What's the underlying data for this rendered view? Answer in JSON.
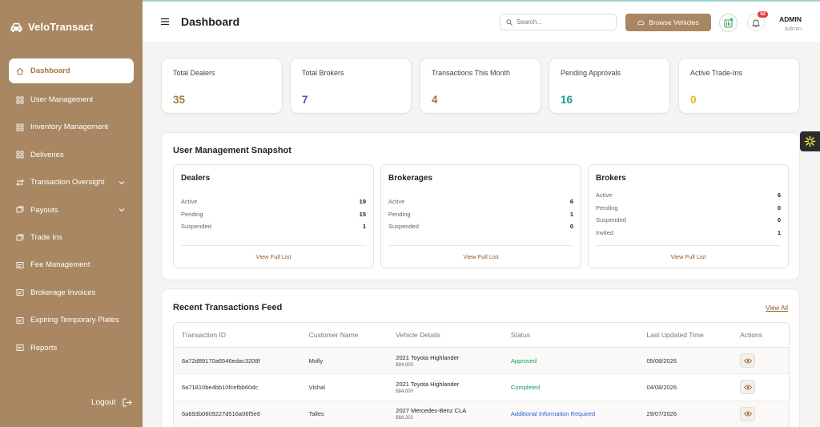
{
  "brand": {
    "name": "VeloTransact"
  },
  "sidebar": {
    "items": [
      {
        "label": "Dashboard",
        "icon": "home-icon"
      },
      {
        "label": "User Management",
        "icon": "grid-icon"
      },
      {
        "label": "Inventory Management",
        "icon": "grid-icon"
      },
      {
        "label": "Deliveries",
        "icon": "grid-icon"
      },
      {
        "label": "Transaction Oversight",
        "icon": "transfer-icon"
      },
      {
        "label": "Payouts",
        "icon": "payout-icon"
      },
      {
        "label": "Trade Ins",
        "icon": "tradein-icon"
      },
      {
        "label": "Fee Management",
        "icon": "fee-icon"
      },
      {
        "label": "Brokerage Invoices",
        "icon": "invoice-icon"
      },
      {
        "label": "Expiring Temporary Plates",
        "icon": "plate-icon"
      },
      {
        "label": "Reports",
        "icon": "report-icon"
      }
    ],
    "logout_label": "Logout"
  },
  "header": {
    "title": "Dashboard",
    "search_placeholder": "Search...",
    "browse_label": "Browse Vehicles",
    "notification_count": "52",
    "user_name": "ADMIN",
    "user_role": "Admin"
  },
  "stats": [
    {
      "label": "Total Dealers",
      "value": "35",
      "color": "#a5763e"
    },
    {
      "label": "Total Brokers",
      "value": "7",
      "color": "#4b52c8"
    },
    {
      "label": "Transactions This Month",
      "value": "4",
      "color": "#a5763e"
    },
    {
      "label": "Pending Approvals",
      "value": "16",
      "color": "#16a085"
    },
    {
      "label": "Active Trade-Ins",
      "value": "0",
      "color": "#e9b318"
    }
  ],
  "snapshot": {
    "title": "User Management Snapshot",
    "link_label": "View Full List",
    "cards": [
      {
        "title": "Dealers",
        "rows": [
          {
            "k": "Active",
            "v": "19"
          },
          {
            "k": "Pending",
            "v": "15"
          },
          {
            "k": "Suspended",
            "v": "1"
          }
        ]
      },
      {
        "title": "Brokerages",
        "rows": [
          {
            "k": "Active",
            "v": "6"
          },
          {
            "k": "Pending",
            "v": "1"
          },
          {
            "k": "Suspended",
            "v": "0"
          }
        ]
      },
      {
        "title": "Brokers",
        "rows": [
          {
            "k": "Active",
            "v": "6"
          },
          {
            "k": "Pending",
            "v": "0"
          },
          {
            "k": "Suspended",
            "v": "0"
          },
          {
            "k": "Invited",
            "v": "1"
          }
        ]
      }
    ]
  },
  "feed": {
    "title": "Recent Transactions Feed",
    "view_all": "View All",
    "columns": [
      "Transaction ID",
      "Customer Name",
      "Vehicle Details",
      "Status",
      "Last Updated Time",
      "Actions"
    ],
    "rows": [
      {
        "id": "6a72d89170a6546edac3208f",
        "customer": "Molly",
        "vehicle": "2021 Toyota Highlander",
        "price": "$84,000",
        "status": "Approved",
        "updated": "05/08/2026"
      },
      {
        "id": "6a71810be4bb10fcefbb60dc",
        "customer": "Vishal",
        "vehicle": "2021 Toyota Highlander",
        "price": "$84,000",
        "status": "Completed",
        "updated": "04/08/2026"
      },
      {
        "id": "6a693b0609227d516a06f5e6",
        "customer": "Talles",
        "vehicle": "2027 Mercedes-Benz CLA",
        "price": "$68,202",
        "status": "Additional Information Required",
        "updated": "29/07/2026"
      }
    ]
  },
  "colors": {
    "sidebar": "#a88762",
    "accent": "#a5763e",
    "link": "#8b5a2b"
  }
}
